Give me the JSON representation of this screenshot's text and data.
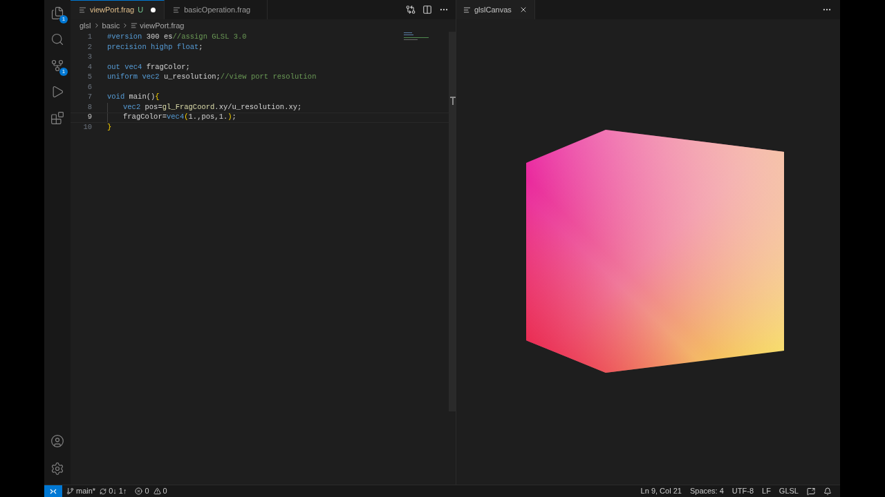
{
  "activity_bar": {
    "items": [
      {
        "kind": "files",
        "badge": "1",
        "selected": false
      },
      {
        "kind": "search",
        "selected": false
      },
      {
        "kind": "source_control",
        "badge": "1",
        "selected": false
      },
      {
        "kind": "run",
        "selected": false
      },
      {
        "kind": "extensions",
        "selected": false
      }
    ],
    "bottom": [
      {
        "kind": "account"
      },
      {
        "kind": "settings"
      }
    ]
  },
  "editor": {
    "tabs": [
      {
        "label": "viewPort.frag",
        "status": "U",
        "modified": true,
        "selected": true
      },
      {
        "label": "basicOperation.frag",
        "modified": false,
        "selected": false
      }
    ],
    "breadcrumb": [
      "glsl",
      "basic",
      "viewPort.frag"
    ],
    "lines": [
      {
        "number": "1",
        "current": false,
        "tokens": [
          {
            "kind": "keyword",
            "text": "#version"
          },
          {
            "kind": "plain",
            "text": " 300 es"
          },
          {
            "kind": "comment",
            "text": "//assign GLSL 3.0"
          }
        ]
      },
      {
        "number": "2",
        "current": false,
        "tokens": [
          {
            "kind": "keyword",
            "text": "precision highp float"
          },
          {
            "kind": "plain",
            "text": ";"
          }
        ]
      },
      {
        "number": "3",
        "current": false
      },
      {
        "number": "4",
        "current": false,
        "tokens": [
          {
            "kind": "keyword",
            "text": "out vec4 "
          },
          {
            "kind": "plain",
            "text": "fragColor;"
          }
        ]
      },
      {
        "number": "5",
        "current": false,
        "tokens": [
          {
            "kind": "keyword",
            "text": "uniform vec2 "
          },
          {
            "kind": "plain",
            "text": "u_resolution;"
          },
          {
            "kind": "comment",
            "text": "//view port resolution"
          }
        ]
      },
      {
        "number": "6",
        "current": false
      },
      {
        "number": "7",
        "current": false,
        "tokens": [
          {
            "kind": "keyword",
            "text": "void "
          },
          {
            "kind": "plain",
            "text": "main()"
          },
          {
            "kind": "bracket",
            "text": "{"
          }
        ]
      },
      {
        "number": "8",
        "current": false,
        "indented": true,
        "tokens": [
          {
            "kind": "keyword",
            "text": "vec2 "
          },
          {
            "kind": "plain",
            "text": "pos="
          },
          {
            "kind": "builtin",
            "text": "gl_FragCoord"
          },
          {
            "kind": "plain",
            "text": ".xy/u_resolution.xy;"
          }
        ]
      },
      {
        "number": "9",
        "current": true,
        "indented": true,
        "tokens": [
          {
            "kind": "plain",
            "text": "fragColor="
          },
          {
            "kind": "keyword",
            "text": "vec4"
          },
          {
            "kind": "bracket",
            "text": "("
          },
          {
            "kind": "plain",
            "text": "1.,pos,1."
          },
          {
            "kind": "bracket",
            "text": ")"
          },
          {
            "kind": "plain",
            "text": ";"
          }
        ]
      },
      {
        "number": "10",
        "current": false,
        "tokens": [
          {
            "kind": "bracket",
            "text": "}"
          }
        ]
      }
    ]
  },
  "preview": {
    "tab": {
      "label": "glslCanvas",
      "selected": true
    }
  },
  "status_bar": {
    "branch": "main*",
    "sync": "0↓ 1↑",
    "errors": "0",
    "warnings": "0",
    "right": [
      "Ln 9, Col 21",
      "Spaces: 4",
      "UTF-8",
      "LF",
      "GLSL"
    ]
  }
}
